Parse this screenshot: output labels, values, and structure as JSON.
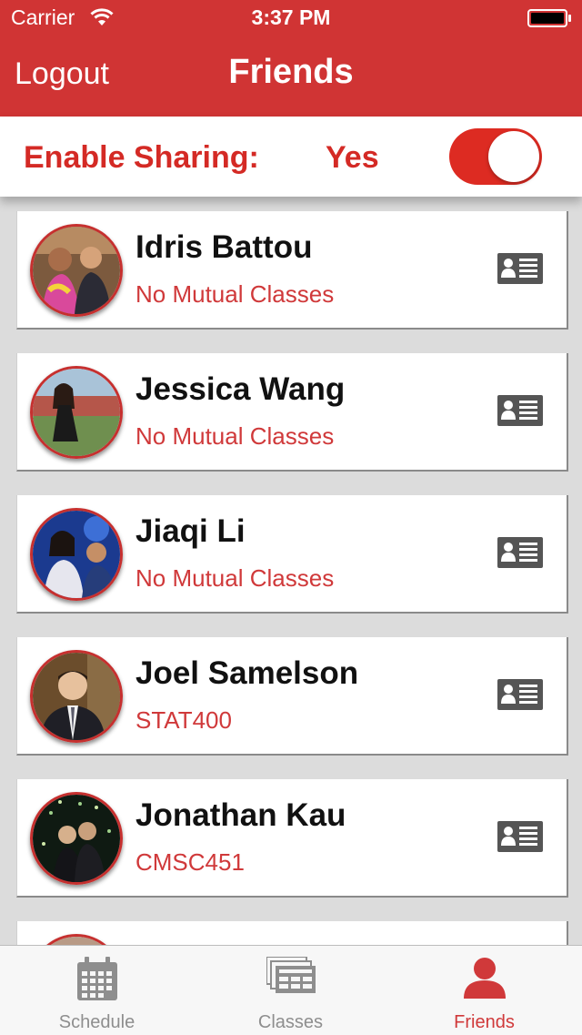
{
  "status_bar": {
    "carrier": "Carrier",
    "time": "3:37 PM"
  },
  "nav": {
    "logout_label": "Logout",
    "title": "Friends"
  },
  "sharing": {
    "label": "Enable Sharing:",
    "value": "Yes",
    "toggle_on": true
  },
  "friends": [
    {
      "name": "Idris Battou",
      "subtitle": "No Mutual Classes",
      "subtitle_kind": "none"
    },
    {
      "name": "Jessica Wang",
      "subtitle": "No Mutual Classes",
      "subtitle_kind": "none"
    },
    {
      "name": "Jiaqi Li",
      "subtitle": "No Mutual Classes",
      "subtitle_kind": "none"
    },
    {
      "name": "Joel Samelson",
      "subtitle": "STAT400",
      "subtitle_kind": "class"
    },
    {
      "name": "Jonathan Kau",
      "subtitle": "CMSC451",
      "subtitle_kind": "class"
    }
  ],
  "tabs": [
    {
      "label": "Schedule",
      "icon": "calendar-icon",
      "active": false
    },
    {
      "label": "Classes",
      "icon": "classes-icon",
      "active": false
    },
    {
      "label": "Friends",
      "icon": "person-icon",
      "active": true
    }
  ],
  "colors": {
    "header": "#d03434",
    "accent": "#d42a25",
    "inactive_tab": "#8e8e8e"
  }
}
